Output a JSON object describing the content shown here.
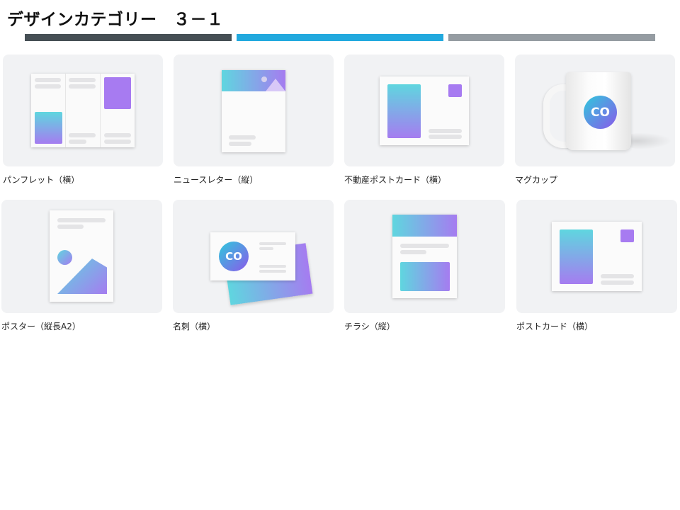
{
  "page": {
    "title": "デザインカテゴリー　３－１"
  },
  "progress_colors": [
    "#464f55",
    "#22a9de",
    "#959ca2"
  ],
  "gradient_colors": [
    "#5fd6df",
    "#a57cf0"
  ],
  "logo_text": "CO",
  "categories": [
    {
      "label": "パンフレット（横）",
      "icon": "tri-fold-brochure-icon"
    },
    {
      "label": "ニュースレター（縦）",
      "icon": "newsletter-icon"
    },
    {
      "label": "不動産ポストカード（横）",
      "icon": "real-estate-postcard-icon"
    },
    {
      "label": "マグカップ",
      "icon": "mug-icon"
    },
    {
      "label": "ポスター（縦長A2）",
      "icon": "poster-icon"
    },
    {
      "label": "名刺（横）",
      "icon": "business-card-icon"
    },
    {
      "label": "チラシ（縦）",
      "icon": "flyer-icon"
    },
    {
      "label": "ポストカード（横）",
      "icon": "postcard-icon"
    }
  ]
}
